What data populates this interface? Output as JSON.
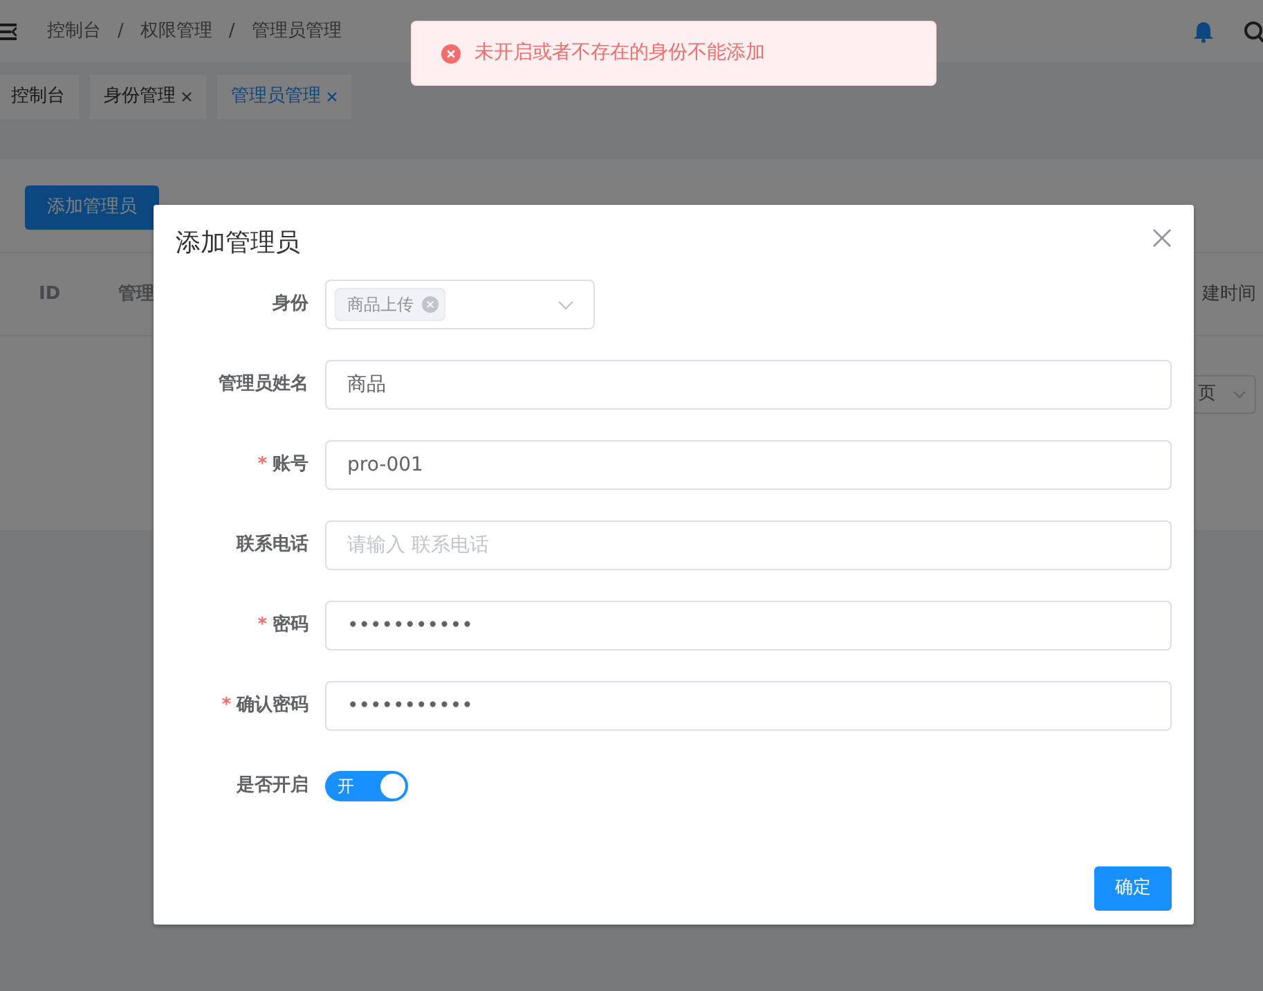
{
  "header": {
    "breadcrumb": [
      "控制台",
      "权限管理",
      "管理员管理"
    ],
    "separator": "/"
  },
  "tabs": [
    {
      "label": "控制台",
      "selected": false,
      "closable": false
    },
    {
      "label": "身份管理",
      "selected": false,
      "closable": true
    },
    {
      "label": "管理员管理",
      "selected": true,
      "closable": true
    }
  ],
  "page": {
    "add_button": "添加管理员",
    "table_columns": [
      "ID",
      "管理",
      "建时间"
    ],
    "pager_select": "页"
  },
  "toast": {
    "kind": "error",
    "message": "未开启或者不存在的身份不能添加"
  },
  "dialog": {
    "title": "添加管理员",
    "required_mark": "*",
    "fields": [
      {
        "kind": "select",
        "label": "身份",
        "required": false,
        "tags": [
          "商品上传"
        ]
      },
      {
        "kind": "text",
        "label": "管理员姓名",
        "required": false,
        "value": "商品"
      },
      {
        "kind": "text",
        "label": "账号",
        "required": true,
        "value": "pro-001"
      },
      {
        "kind": "text",
        "label": "联系电话",
        "required": false,
        "placeholder": "请输入 联系电话"
      },
      {
        "kind": "text",
        "label": "密码",
        "required": true,
        "value": "•••••••••••"
      },
      {
        "kind": "text",
        "label": "确认密码",
        "required": true,
        "value": "•••••••••••"
      },
      {
        "kind": "switch",
        "label": "是否开启",
        "required": false,
        "on": true,
        "text": "开"
      }
    ],
    "confirm_button": "确定"
  }
}
